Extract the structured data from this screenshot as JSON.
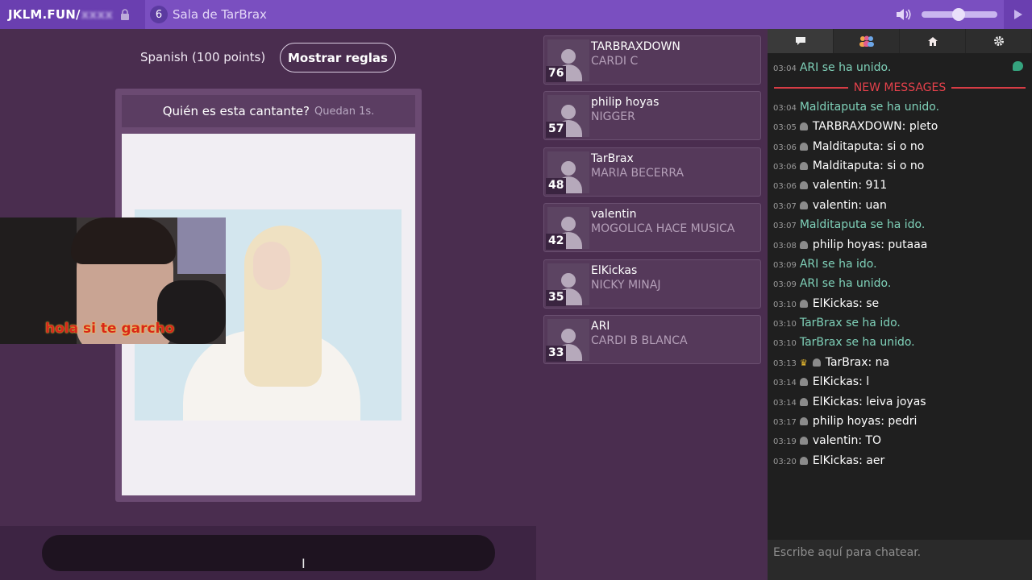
{
  "topbar": {
    "brand": "JKLM.FUN/",
    "room_code": "xxxx",
    "player_count": "6",
    "room_name": "Sala de TarBrax",
    "icons": [
      "lock-icon",
      "volume-icon",
      "volume-slider",
      "play-icon"
    ]
  },
  "game": {
    "dictionary": "Spanish (100 points)",
    "rules_button": "Mostrar reglas",
    "question": "Quién es esta cantante?",
    "timer": "Quedan 1s.",
    "webcam_caption": "hola si te garcho"
  },
  "players": [
    {
      "name": "TARBRAXDOWN",
      "answer": "CARDI C",
      "score": "76"
    },
    {
      "name": "philip hoyas",
      "answer": "NIGGER",
      "score": "57"
    },
    {
      "name": "TarBrax",
      "answer": "MARIA BECERRA",
      "score": "48"
    },
    {
      "name": "valentin",
      "answer": "MOGOLICA HACE MUSICA",
      "score": "42"
    },
    {
      "name": "ElKickas",
      "answer": "NICKY MINAJ",
      "score": "35"
    },
    {
      "name": "ARI",
      "answer": "CARDI B BLANCA",
      "score": "33"
    }
  ],
  "chat": {
    "tabs": [
      "chat-icon",
      "players-icon",
      "home-icon",
      "settings-icon"
    ],
    "new_messages_label": "NEW MESSAGES",
    "placeholder": "Escribe aquí para chatear.",
    "messages": [
      {
        "time": "03:04",
        "kind": "system",
        "text": "ARI se ha unido."
      },
      {
        "time": "03:04",
        "kind": "system",
        "text": "Malditaputa se ha unido."
      },
      {
        "time": "03:05",
        "kind": "user",
        "user": "TARBRAXDOWN",
        "text": "pleto"
      },
      {
        "time": "03:06",
        "kind": "user",
        "user": "Malditaputa",
        "text": "si o no"
      },
      {
        "time": "03:06",
        "kind": "user",
        "user": "Malditaputa",
        "text": "si o no"
      },
      {
        "time": "03:06",
        "kind": "user",
        "user": "valentin",
        "text": "911"
      },
      {
        "time": "03:07",
        "kind": "user",
        "user": "valentin",
        "text": "uan"
      },
      {
        "time": "03:07",
        "kind": "system",
        "text": "Malditaputa se ha ido."
      },
      {
        "time": "03:08",
        "kind": "user",
        "user": "philip hoyas",
        "text": "putaaa"
      },
      {
        "time": "03:09",
        "kind": "system",
        "text": "ARI se ha ido."
      },
      {
        "time": "03:09",
        "kind": "system",
        "text": "ARI se ha unido."
      },
      {
        "time": "03:10",
        "kind": "user",
        "user": "ElKickas",
        "text": "se"
      },
      {
        "time": "03:10",
        "kind": "system",
        "text": "TarBrax se ha ido."
      },
      {
        "time": "03:10",
        "kind": "system",
        "text": "TarBrax se ha unido."
      },
      {
        "time": "03:13",
        "kind": "leader",
        "user": "TarBrax",
        "text": "na"
      },
      {
        "time": "03:14",
        "kind": "user",
        "user": "ElKickas",
        "text": "l"
      },
      {
        "time": "03:14",
        "kind": "user",
        "user": "ElKickas",
        "text": "leiva joyas"
      },
      {
        "time": "03:17",
        "kind": "user",
        "user": "philip hoyas",
        "text": "pedri"
      },
      {
        "time": "03:19",
        "kind": "user",
        "user": "valentin",
        "text": "TO"
      },
      {
        "time": "03:20",
        "kind": "user",
        "user": "ElKickas",
        "text": "aer"
      }
    ]
  }
}
